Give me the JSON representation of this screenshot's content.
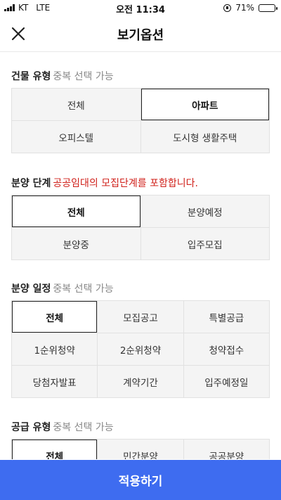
{
  "status_bar": {
    "carrier": "KT",
    "network": "LTE",
    "time": "오전 11:34",
    "battery": "71%",
    "battery_level": 0.71
  },
  "header": {
    "title": "보기옵션",
    "close_icon": "close-icon"
  },
  "sections": [
    {
      "title": "건물 유형",
      "note": "중복 선택 가능",
      "options": [
        "전체",
        "아파트",
        "오피스텔",
        "도시형 생활주택"
      ],
      "selected": [
        1
      ]
    },
    {
      "title": "분양 단계",
      "note": "공공임대의 모집단계를 포함합니다.",
      "options": [
        "전체",
        "분양예정",
        "분양중",
        "입주모집"
      ],
      "selected": [
        0
      ]
    },
    {
      "title": "분양 일정",
      "note": "중복 선택 가능",
      "options": [
        "전체",
        "모집공고",
        "특별공급",
        "1순위청약",
        "2순위청약",
        "청약접수",
        "당첨자발표",
        "계약기간",
        "입주예정일"
      ],
      "selected": [
        0
      ]
    },
    {
      "title": "공급 유형",
      "note": "중복 선택 가능",
      "options": [
        "전체",
        "민간분양",
        "공공분양"
      ],
      "selected": [
        0
      ]
    }
  ],
  "apply_button": "적용하기",
  "colors": {
    "accent": "#3e6cf0",
    "note_red": "#d0201a",
    "note_gray": "#888888"
  }
}
